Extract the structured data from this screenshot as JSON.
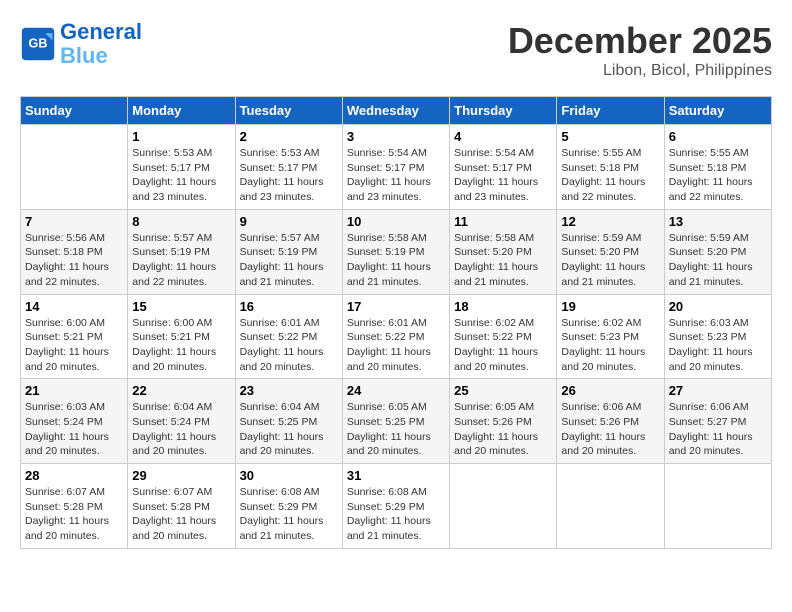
{
  "header": {
    "logo_line1": "General",
    "logo_line2": "Blue",
    "month": "December 2025",
    "location": "Libon, Bicol, Philippines"
  },
  "weekdays": [
    "Sunday",
    "Monday",
    "Tuesday",
    "Wednesday",
    "Thursday",
    "Friday",
    "Saturday"
  ],
  "weeks": [
    [
      {
        "day": "",
        "sunrise": "",
        "sunset": "",
        "daylight": ""
      },
      {
        "day": "1",
        "sunrise": "5:53 AM",
        "sunset": "5:17 PM",
        "daylight": "11 hours and 23 minutes."
      },
      {
        "day": "2",
        "sunrise": "5:53 AM",
        "sunset": "5:17 PM",
        "daylight": "11 hours and 23 minutes."
      },
      {
        "day": "3",
        "sunrise": "5:54 AM",
        "sunset": "5:17 PM",
        "daylight": "11 hours and 23 minutes."
      },
      {
        "day": "4",
        "sunrise": "5:54 AM",
        "sunset": "5:17 PM",
        "daylight": "11 hours and 23 minutes."
      },
      {
        "day": "5",
        "sunrise": "5:55 AM",
        "sunset": "5:18 PM",
        "daylight": "11 hours and 22 minutes."
      },
      {
        "day": "6",
        "sunrise": "5:55 AM",
        "sunset": "5:18 PM",
        "daylight": "11 hours and 22 minutes."
      }
    ],
    [
      {
        "day": "7",
        "sunrise": "5:56 AM",
        "sunset": "5:18 PM",
        "daylight": "11 hours and 22 minutes."
      },
      {
        "day": "8",
        "sunrise": "5:57 AM",
        "sunset": "5:19 PM",
        "daylight": "11 hours and 22 minutes."
      },
      {
        "day": "9",
        "sunrise": "5:57 AM",
        "sunset": "5:19 PM",
        "daylight": "11 hours and 21 minutes."
      },
      {
        "day": "10",
        "sunrise": "5:58 AM",
        "sunset": "5:19 PM",
        "daylight": "11 hours and 21 minutes."
      },
      {
        "day": "11",
        "sunrise": "5:58 AM",
        "sunset": "5:20 PM",
        "daylight": "11 hours and 21 minutes."
      },
      {
        "day": "12",
        "sunrise": "5:59 AM",
        "sunset": "5:20 PM",
        "daylight": "11 hours and 21 minutes."
      },
      {
        "day": "13",
        "sunrise": "5:59 AM",
        "sunset": "5:20 PM",
        "daylight": "11 hours and 21 minutes."
      }
    ],
    [
      {
        "day": "14",
        "sunrise": "6:00 AM",
        "sunset": "5:21 PM",
        "daylight": "11 hours and 20 minutes."
      },
      {
        "day": "15",
        "sunrise": "6:00 AM",
        "sunset": "5:21 PM",
        "daylight": "11 hours and 20 minutes."
      },
      {
        "day": "16",
        "sunrise": "6:01 AM",
        "sunset": "5:22 PM",
        "daylight": "11 hours and 20 minutes."
      },
      {
        "day": "17",
        "sunrise": "6:01 AM",
        "sunset": "5:22 PM",
        "daylight": "11 hours and 20 minutes."
      },
      {
        "day": "18",
        "sunrise": "6:02 AM",
        "sunset": "5:22 PM",
        "daylight": "11 hours and 20 minutes."
      },
      {
        "day": "19",
        "sunrise": "6:02 AM",
        "sunset": "5:23 PM",
        "daylight": "11 hours and 20 minutes."
      },
      {
        "day": "20",
        "sunrise": "6:03 AM",
        "sunset": "5:23 PM",
        "daylight": "11 hours and 20 minutes."
      }
    ],
    [
      {
        "day": "21",
        "sunrise": "6:03 AM",
        "sunset": "5:24 PM",
        "daylight": "11 hours and 20 minutes."
      },
      {
        "day": "22",
        "sunrise": "6:04 AM",
        "sunset": "5:24 PM",
        "daylight": "11 hours and 20 minutes."
      },
      {
        "day": "23",
        "sunrise": "6:04 AM",
        "sunset": "5:25 PM",
        "daylight": "11 hours and 20 minutes."
      },
      {
        "day": "24",
        "sunrise": "6:05 AM",
        "sunset": "5:25 PM",
        "daylight": "11 hours and 20 minutes."
      },
      {
        "day": "25",
        "sunrise": "6:05 AM",
        "sunset": "5:26 PM",
        "daylight": "11 hours and 20 minutes."
      },
      {
        "day": "26",
        "sunrise": "6:06 AM",
        "sunset": "5:26 PM",
        "daylight": "11 hours and 20 minutes."
      },
      {
        "day": "27",
        "sunrise": "6:06 AM",
        "sunset": "5:27 PM",
        "daylight": "11 hours and 20 minutes."
      }
    ],
    [
      {
        "day": "28",
        "sunrise": "6:07 AM",
        "sunset": "5:28 PM",
        "daylight": "11 hours and 20 minutes."
      },
      {
        "day": "29",
        "sunrise": "6:07 AM",
        "sunset": "5:28 PM",
        "daylight": "11 hours and 20 minutes."
      },
      {
        "day": "30",
        "sunrise": "6:08 AM",
        "sunset": "5:29 PM",
        "daylight": "11 hours and 21 minutes."
      },
      {
        "day": "31",
        "sunrise": "6:08 AM",
        "sunset": "5:29 PM",
        "daylight": "11 hours and 21 minutes."
      },
      {
        "day": "",
        "sunrise": "",
        "sunset": "",
        "daylight": ""
      },
      {
        "day": "",
        "sunrise": "",
        "sunset": "",
        "daylight": ""
      },
      {
        "day": "",
        "sunrise": "",
        "sunset": "",
        "daylight": ""
      }
    ]
  ]
}
